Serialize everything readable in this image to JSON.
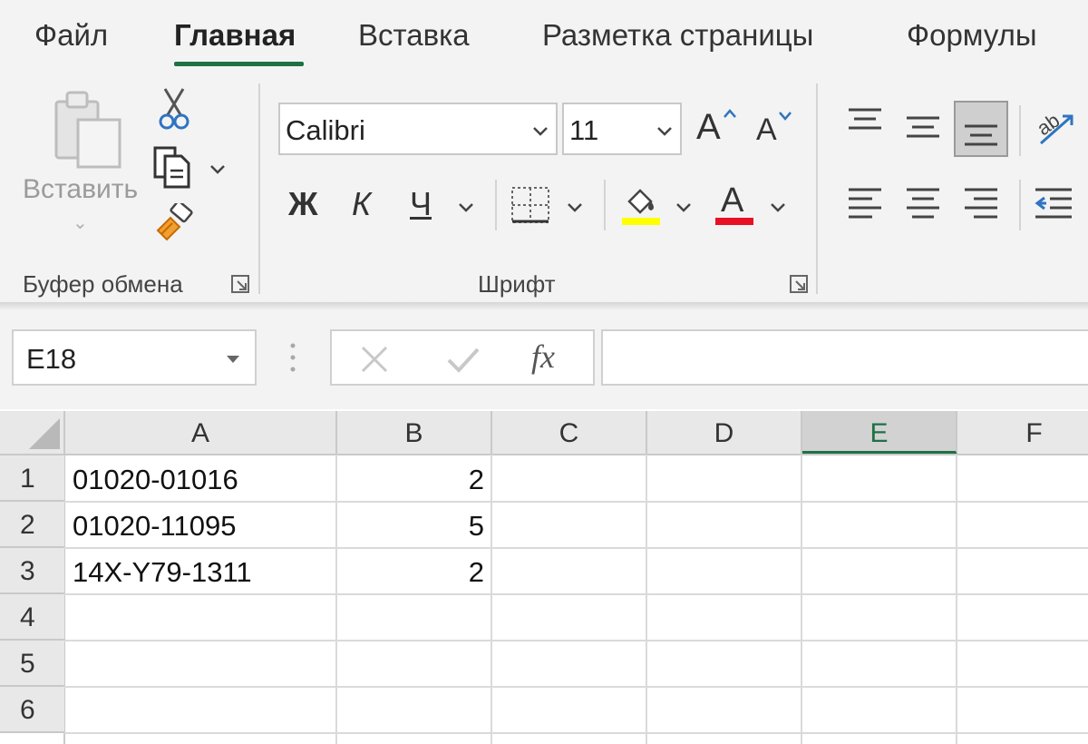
{
  "ribbon": {
    "tabs": [
      {
        "label": "Файл",
        "active": false
      },
      {
        "label": "Главная",
        "active": true
      },
      {
        "label": "Вставка",
        "active": false
      },
      {
        "label": "Разметка страницы",
        "active": false
      },
      {
        "label": "Формулы",
        "active": false
      }
    ],
    "clipboard": {
      "group_label": "Буфер обмена",
      "paste_label": "Вставить",
      "paste_caret": "⌄"
    },
    "font": {
      "group_label": "Шрифт",
      "font_name": "Calibri",
      "font_size": "11",
      "bold_glyph": "Ж",
      "italic_glyph": "К",
      "underline_glyph": "Ч",
      "grow_glyph": "A",
      "shrink_glyph": "A",
      "font_color_glyph": "A",
      "highlight_color": "#ffff00",
      "font_color": "#e81123"
    },
    "accent_color": "#1e7145"
  },
  "formula_bar": {
    "name_box": "E18",
    "fx_label": "fx",
    "formula": ""
  },
  "grid": {
    "columns": [
      "A",
      "B",
      "C",
      "D",
      "E",
      "F"
    ],
    "selected_column": "E",
    "rows": [
      "1",
      "2",
      "3",
      "4",
      "5",
      "6"
    ],
    "cells": [
      {
        "a": "01020-01016",
        "b": "2"
      },
      {
        "a": "01020-11095",
        "b": "5"
      },
      {
        "a": "14X-Y79-1311",
        "b": "2"
      }
    ]
  }
}
